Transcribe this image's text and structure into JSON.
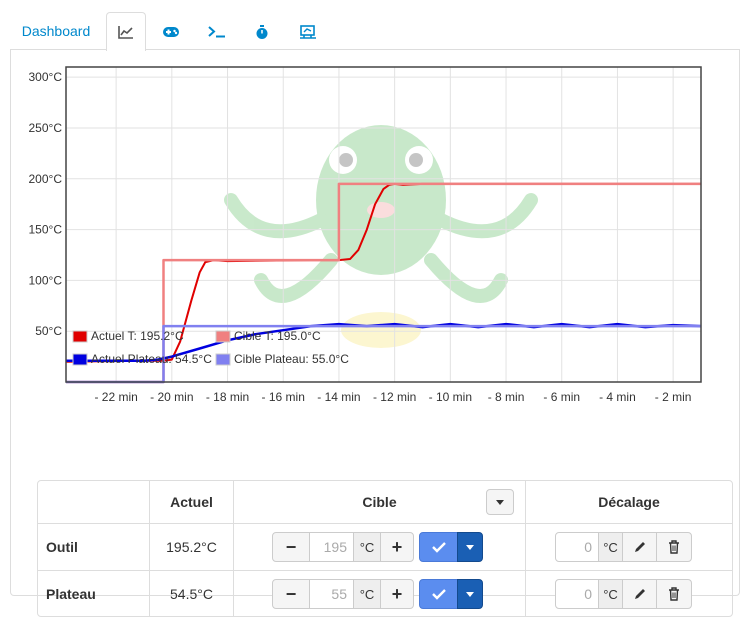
{
  "tabs": [
    {
      "label": "Dashboard",
      "icon": "",
      "active": false
    },
    {
      "label": "",
      "icon": "line-chart-icon",
      "active": true
    },
    {
      "label": "",
      "icon": "gamepad-icon",
      "active": false
    },
    {
      "label": "",
      "icon": "terminal-icon",
      "active": false
    },
    {
      "label": "",
      "icon": "stopwatch-icon",
      "active": false
    },
    {
      "label": "",
      "icon": "timelapse-icon",
      "active": false
    }
  ],
  "chart_data": {
    "type": "line",
    "ylim": [
      0,
      310
    ],
    "xlim": [
      -23.8,
      -1.0
    ],
    "y_ticks": [
      50,
      100,
      150,
      200,
      250,
      300
    ],
    "y_tick_labels": [
      "50°C",
      "100°C",
      "150°C",
      "200°C",
      "250°C",
      "300°C"
    ],
    "x_ticks": [
      -22,
      -20,
      -18,
      -16,
      -14,
      -12,
      -10,
      -8,
      -6,
      -4,
      -2
    ],
    "x_tick_labels": [
      "- 22 min",
      "- 20 min",
      "- 18 min",
      "- 16 min",
      "- 14 min",
      "- 12 min",
      "- 10 min",
      "- 8 min",
      "- 6 min",
      "- 4 min",
      "- 2 min"
    ],
    "grid": true,
    "legend_position": "bottom-left",
    "series": [
      {
        "name": "Actuel T: 195.2°C",
        "color": "#e00000",
        "x": [
          -23.8,
          -21.0,
          -20.3,
          -20.0,
          -19.7,
          -19.3,
          -19.0,
          -18.8,
          -18.5,
          -18.0,
          -15.0,
          -14.0,
          -13.6,
          -13.3,
          -13.0,
          -12.7,
          -12.4,
          -12.2,
          -12.0,
          -11.7,
          -11.0,
          -1.0
        ],
        "y": [
          20,
          21,
          21,
          22,
          40,
          80,
          108,
          118,
          120,
          119,
          120,
          120,
          121,
          130,
          150,
          175,
          190,
          194,
          195,
          194,
          195,
          195
        ]
      },
      {
        "name": "Cible T: 195.0°C",
        "color": "#f08080",
        "x": [
          -23.8,
          -20.3,
          -20.3,
          -14.0,
          -14.0,
          -1.0
        ],
        "y": [
          0,
          0,
          120,
          120,
          195,
          195
        ]
      },
      {
        "name": "Actuel Plateau: 54.5°C",
        "color": "#0000e0",
        "x": [
          -23.8,
          -21.0,
          -20.5,
          -20.0,
          -19.0,
          -18.0,
          -17.0,
          -16.0,
          -15.0,
          -14.0,
          -13.0,
          -12.0,
          -11.0,
          -10.0,
          -9.0,
          -8.0,
          -7.0,
          -6.0,
          -5.0,
          -4.0,
          -3.0,
          -2.0,
          -1.0
        ],
        "y": [
          21,
          21,
          22,
          25,
          33,
          41,
          47,
          51,
          55,
          57,
          55,
          57,
          54,
          57,
          54,
          57,
          54,
          57,
          54,
          57,
          54,
          56,
          55
        ]
      },
      {
        "name": "Cible Plateau: 55.0°C",
        "color": "#8080f0",
        "x": [
          -23.8,
          -20.3,
          -20.3,
          -1.0
        ],
        "y": [
          0,
          0,
          55,
          55
        ]
      }
    ]
  },
  "table": {
    "headers": {
      "actual": "Actuel",
      "target": "Cible",
      "offset": "Décalage"
    },
    "rows": [
      {
        "label": "Outil",
        "actual": "195.2°C",
        "target_value": "195",
        "offset_value": "0"
      },
      {
        "label": "Plateau",
        "actual": "54.5°C",
        "target_value": "55",
        "offset_value": "0"
      }
    ],
    "unit": "°C",
    "minus": "−",
    "plus": "+"
  }
}
